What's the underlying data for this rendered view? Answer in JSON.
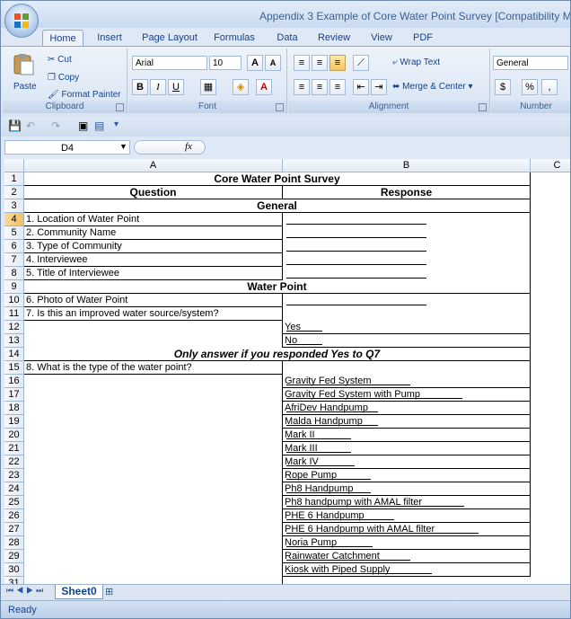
{
  "window": {
    "title": "Appendix 3  Example of Core Water Point Survey  [Compatibility M"
  },
  "tabs": [
    "Home",
    "Insert",
    "Page Layout",
    "Formulas",
    "Data",
    "Review",
    "View",
    "PDF"
  ],
  "ribbon": {
    "clipboard": {
      "paste": "Paste",
      "cut": "Cut",
      "copy": "Copy",
      "format_painter": "Format Painter",
      "label": "Clipboard"
    },
    "font": {
      "name": "Arial",
      "size": "10",
      "grow": "A",
      "shrink": "A",
      "bold": "B",
      "italic": "I",
      "underline": "U",
      "label": "Font"
    },
    "alignment": {
      "wrap_text": "Wrap Text",
      "merge_center": "Merge & Center",
      "label": "Alignment"
    },
    "number": {
      "format": "General",
      "currency": "$",
      "percent": "%",
      "comma": ",",
      "label": "Number"
    }
  },
  "formula_bar": {
    "name_box": "D4",
    "fx": "fx"
  },
  "columns": [
    "A",
    "B",
    "C"
  ],
  "rows": [
    {
      "n": "1",
      "a": "",
      "b": "Core Water Point Survey",
      "style": "title"
    },
    {
      "n": "2",
      "a": "Question",
      "b": "Response",
      "style": "header"
    },
    {
      "n": "3",
      "a": "",
      "b": "General",
      "style": "section"
    },
    {
      "n": "4",
      "a": "1. Location of Water Point",
      "b": ""
    },
    {
      "n": "5",
      "a": "2. Community Name",
      "b": ""
    },
    {
      "n": "6",
      "a": "3. Type of Community",
      "b": ""
    },
    {
      "n": "7",
      "a": "4. Interviewee",
      "b": ""
    },
    {
      "n": "8",
      "a": "5. Title of Interviewee",
      "b": ""
    },
    {
      "n": "9",
      "a": "",
      "b": "Water Point",
      "style": "section"
    },
    {
      "n": "10",
      "a": "6. Photo of Water Point",
      "b": ""
    },
    {
      "n": "11",
      "a": "7. Is this an improved water source/system?",
      "b": ""
    },
    {
      "n": "12",
      "a": "",
      "b": "Yes"
    },
    {
      "n": "13",
      "a": "",
      "b": "No"
    },
    {
      "n": "14",
      "a": "",
      "b": "Only answer if you responded Yes to Q7",
      "style": "note"
    },
    {
      "n": "15",
      "a": "8. What is the type of the water point?",
      "b": ""
    },
    {
      "n": "16",
      "a": "",
      "b": "Gravity Fed System"
    },
    {
      "n": "17",
      "a": "",
      "b": "Gravity Fed System with Pump"
    },
    {
      "n": "18",
      "a": "",
      "b": "AfriDev Handpump"
    },
    {
      "n": "19",
      "a": "",
      "b": "Malda Handpump"
    },
    {
      "n": "20",
      "a": "",
      "b": "Mark II"
    },
    {
      "n": "21",
      "a": "",
      "b": "Mark III"
    },
    {
      "n": "22",
      "a": "",
      "b": "Mark IV"
    },
    {
      "n": "23",
      "a": "",
      "b": "Rope Pump"
    },
    {
      "n": "24",
      "a": "",
      "b": "Ph8 Handpump"
    },
    {
      "n": "25",
      "a": "",
      "b": "Ph8 handpump with AMAL filter"
    },
    {
      "n": "26",
      "a": "",
      "b": "PHE 6 Handpump"
    },
    {
      "n": "27",
      "a": "",
      "b": "PHE 6 Handpump with AMAL filter"
    },
    {
      "n": "28",
      "a": "",
      "b": "Noria Pump"
    },
    {
      "n": "29",
      "a": "",
      "b": "Rainwater Catchment"
    },
    {
      "n": "30",
      "a": "",
      "b": "Kiosk with Piped Supply"
    },
    {
      "n": "31",
      "a": "",
      "b": ""
    }
  ],
  "sheet_tab": "Sheet0",
  "status": "Ready"
}
